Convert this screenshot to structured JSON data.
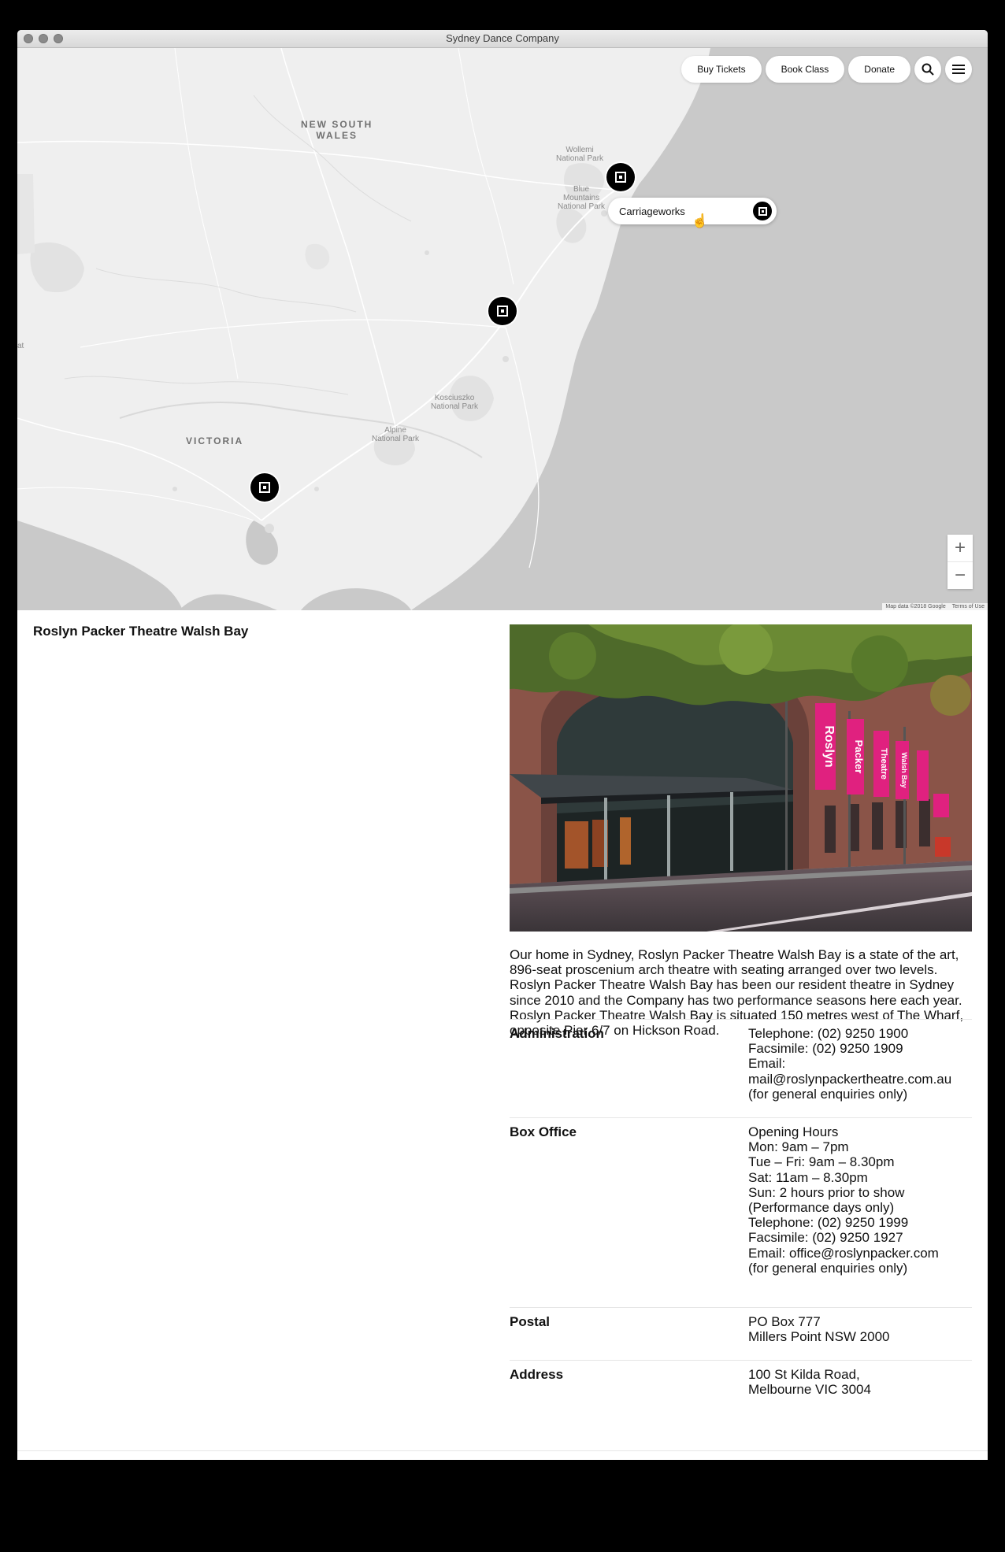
{
  "window": {
    "title": "Sydney Dance Company"
  },
  "nav": {
    "buy_tickets": "Buy Tickets",
    "book_class": "Book Class",
    "donate": "Donate"
  },
  "map": {
    "region_labels": [
      "NEW SOUTH\nWALES",
      "VICTORIA"
    ],
    "park_labels": [
      "Wollemi\nNational Park",
      "Blue\nMountains\nNational Park",
      "Kosciuszko\nNational Park",
      "Alpine\nNational Park"
    ],
    "tooltip_label": "Carriageworks",
    "zoom_in": "+",
    "zoom_out": "−",
    "attribution": "Map data ©2018 Google",
    "terms": "Terms of Use",
    "edge_label": "at"
  },
  "venue": {
    "title": "Roslyn Packer Theatre Walsh Bay",
    "banner_words": [
      "Roslyn",
      "Packer",
      "Theatre",
      "Walsh Bay"
    ],
    "description": "Our home in Sydney, Roslyn Packer Theatre Walsh Bay is a state of the art, 896-seat proscenium arch theatre with seating arranged over two levels. Roslyn Packer Theatre Walsh Bay has been our resident theatre in Sydney since 2010 and the Company has two performance seasons here each year. Roslyn Packer Theatre Walsh Bay is situated 150 metres west of The Wharf, opposite Pier 6/7 on Hickson Road.",
    "details": [
      {
        "label": "Administration",
        "value": "Telephone: (02) 9250 1900\nFacsimile: (02) 9250 1909\nEmail:\nmail@roslynpackertheatre.com.au\n(for general enquiries only)"
      },
      {
        "label": "Box Office",
        "value": "Opening Hours\nMon: 9am – 7pm\nTue – Fri: 9am – 8.30pm\nSat: 11am – 8.30pm\nSun: 2 hours prior to show\n(Performance days only)\nTelephone: (02) 9250 1999\nFacsimile: (02) 9250 1927\nEmail:  office@roslynpacker.com\n(for general enquiries only)"
      },
      {
        "label": "Postal",
        "value": "PO Box 777\nMillers Point NSW 2000"
      },
      {
        "label": "Address",
        "value": "100 St Kilda Road,\nMelbourne VIC 3004"
      }
    ]
  },
  "colors": {
    "land": "#efefef",
    "water": "#c9c9c9",
    "marker": "#000000",
    "banner_pink": "#e0217f"
  }
}
